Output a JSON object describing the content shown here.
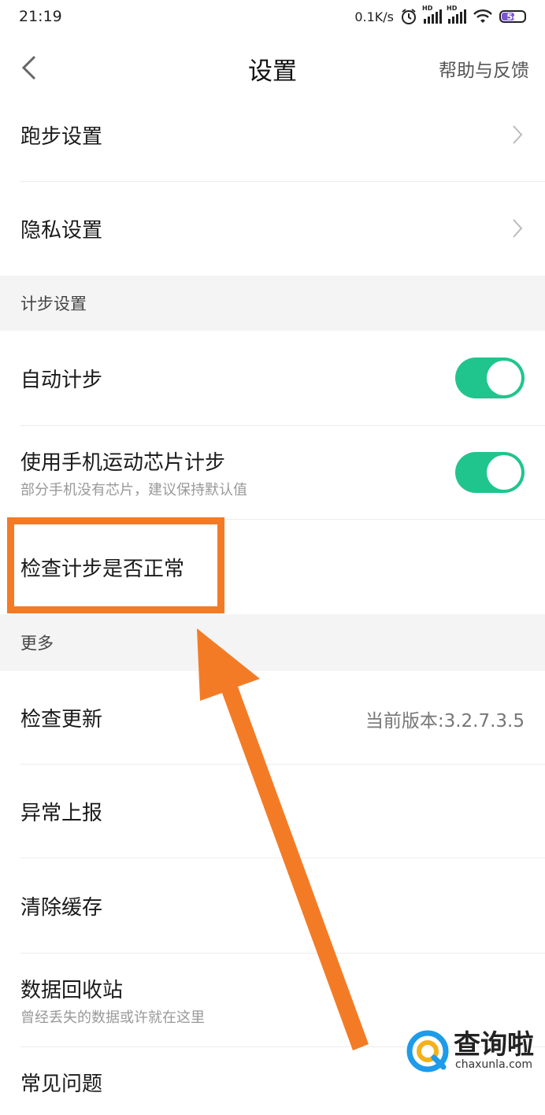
{
  "status": {
    "time": "21:19",
    "speed": "0.1K/s",
    "hd": "HD",
    "battery": "54"
  },
  "header": {
    "title": "设置",
    "help": "帮助与反馈"
  },
  "items": {
    "run": "跑步设置",
    "privacy": "隐私设置",
    "auto_step": "自动计步",
    "chip_step": "使用手机运动芯片计步",
    "chip_step_sub": "部分手机没有芯片，建议保持默认值",
    "check_step": "检查计步是否正常",
    "check_update": "检查更新",
    "version": "当前版本:3.2.7.3.5",
    "report": "异常上报",
    "clear_cache": "清除缓存",
    "recycle": "数据回收站",
    "recycle_sub": "曾经丢失的数据或许就在这里",
    "faq": "常见问题"
  },
  "sections": {
    "step": "计步设置",
    "more": "更多"
  },
  "toggles": {
    "auto_step": true,
    "chip_step": true
  },
  "colors": {
    "accent": "#20c58d",
    "annotation": "#f47b25"
  },
  "watermark": {
    "cn": "查询啦",
    "en": "chaxunla.com"
  }
}
